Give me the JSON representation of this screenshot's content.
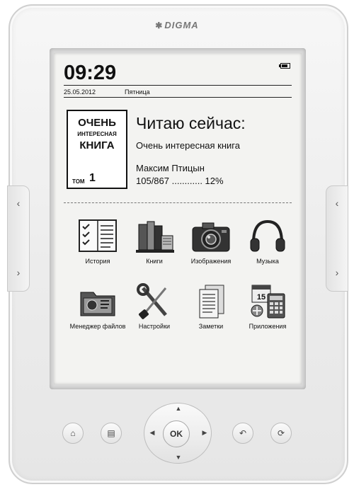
{
  "device": {
    "brand": "DIGMA"
  },
  "status": {
    "time": "09:29",
    "date": "25.05.2012",
    "weekday": "Пятница"
  },
  "current_book": {
    "heading": "Читаю сейчас:",
    "title": "Очень интересная книга",
    "author": "Максим Птицын",
    "progress_text": "105/867 ............ 12%",
    "progress_percent": 12,
    "cover": {
      "line1": "ОЧЕНЬ",
      "line2": "ИНТЕРЕСНАЯ",
      "line3": "КНИГА",
      "volume_label": "ТОМ",
      "volume_number": "1"
    }
  },
  "apps": [
    {
      "label": "История",
      "icon": "history-checklist-icon"
    },
    {
      "label": "Книги",
      "icon": "books-icon"
    },
    {
      "label": "Изображения",
      "icon": "camera-icon"
    },
    {
      "label": "Музыка",
      "icon": "headphones-icon"
    },
    {
      "label": "Менеджер файлов",
      "icon": "file-manager-icon"
    },
    {
      "label": "Настройки",
      "icon": "settings-tools-icon"
    },
    {
      "label": "Заметки",
      "icon": "notes-icon"
    },
    {
      "label": "Приложения",
      "icon": "apps-calendar-calculator-icon"
    }
  ],
  "hardware": {
    "ok_label": "OK"
  }
}
